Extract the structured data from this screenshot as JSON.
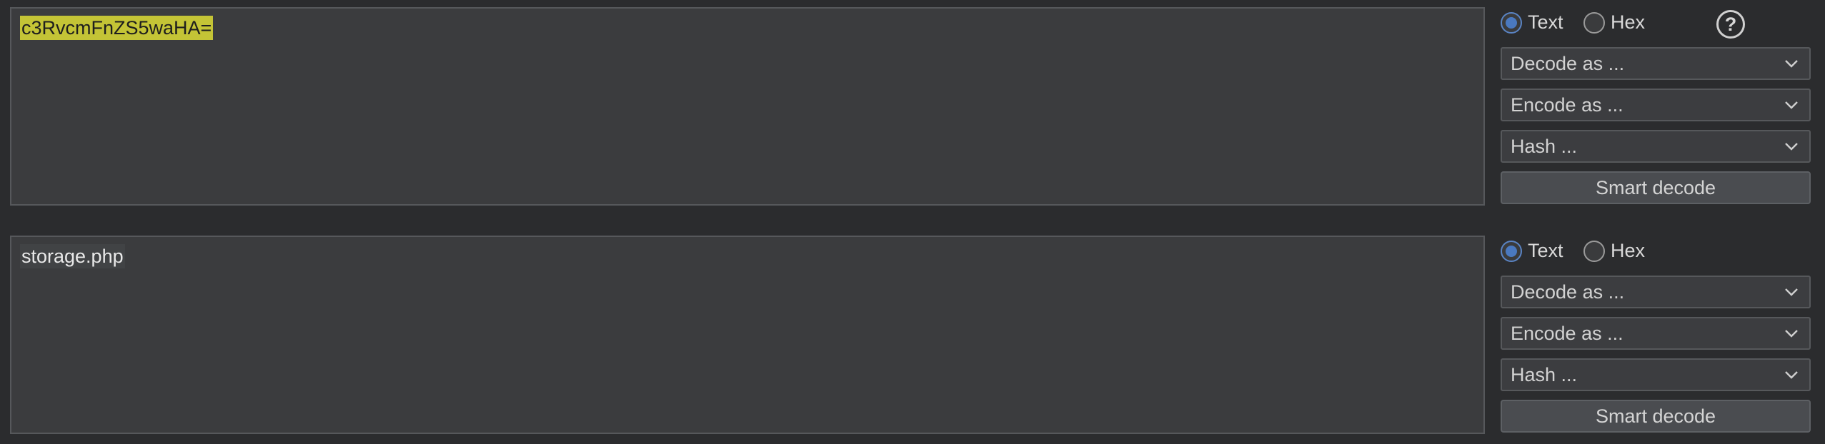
{
  "panels": [
    {
      "text": "c3RvcmFnZS5waHA=",
      "mode_text_label": "Text",
      "mode_hex_label": "Hex",
      "selected_mode": "Text",
      "decode_label": "Decode as ...",
      "encode_label": "Encode as ...",
      "hash_label": "Hash ...",
      "smart_decode_label": "Smart decode",
      "help_label": "?"
    },
    {
      "text": "storage.php",
      "mode_text_label": "Text",
      "mode_hex_label": "Hex",
      "selected_mode": "Text",
      "decode_label": "Decode as ...",
      "encode_label": "Encode as ...",
      "hash_label": "Hash ...",
      "smart_decode_label": "Smart decode"
    }
  ],
  "icons": {
    "help": "help-icon",
    "dropdown": "chevron-down-icon"
  },
  "colors": {
    "background": "#2b2c2e",
    "textarea": "#3b3c3e",
    "highlight": "#c4c436",
    "radio_selected": "#4a79c0"
  }
}
